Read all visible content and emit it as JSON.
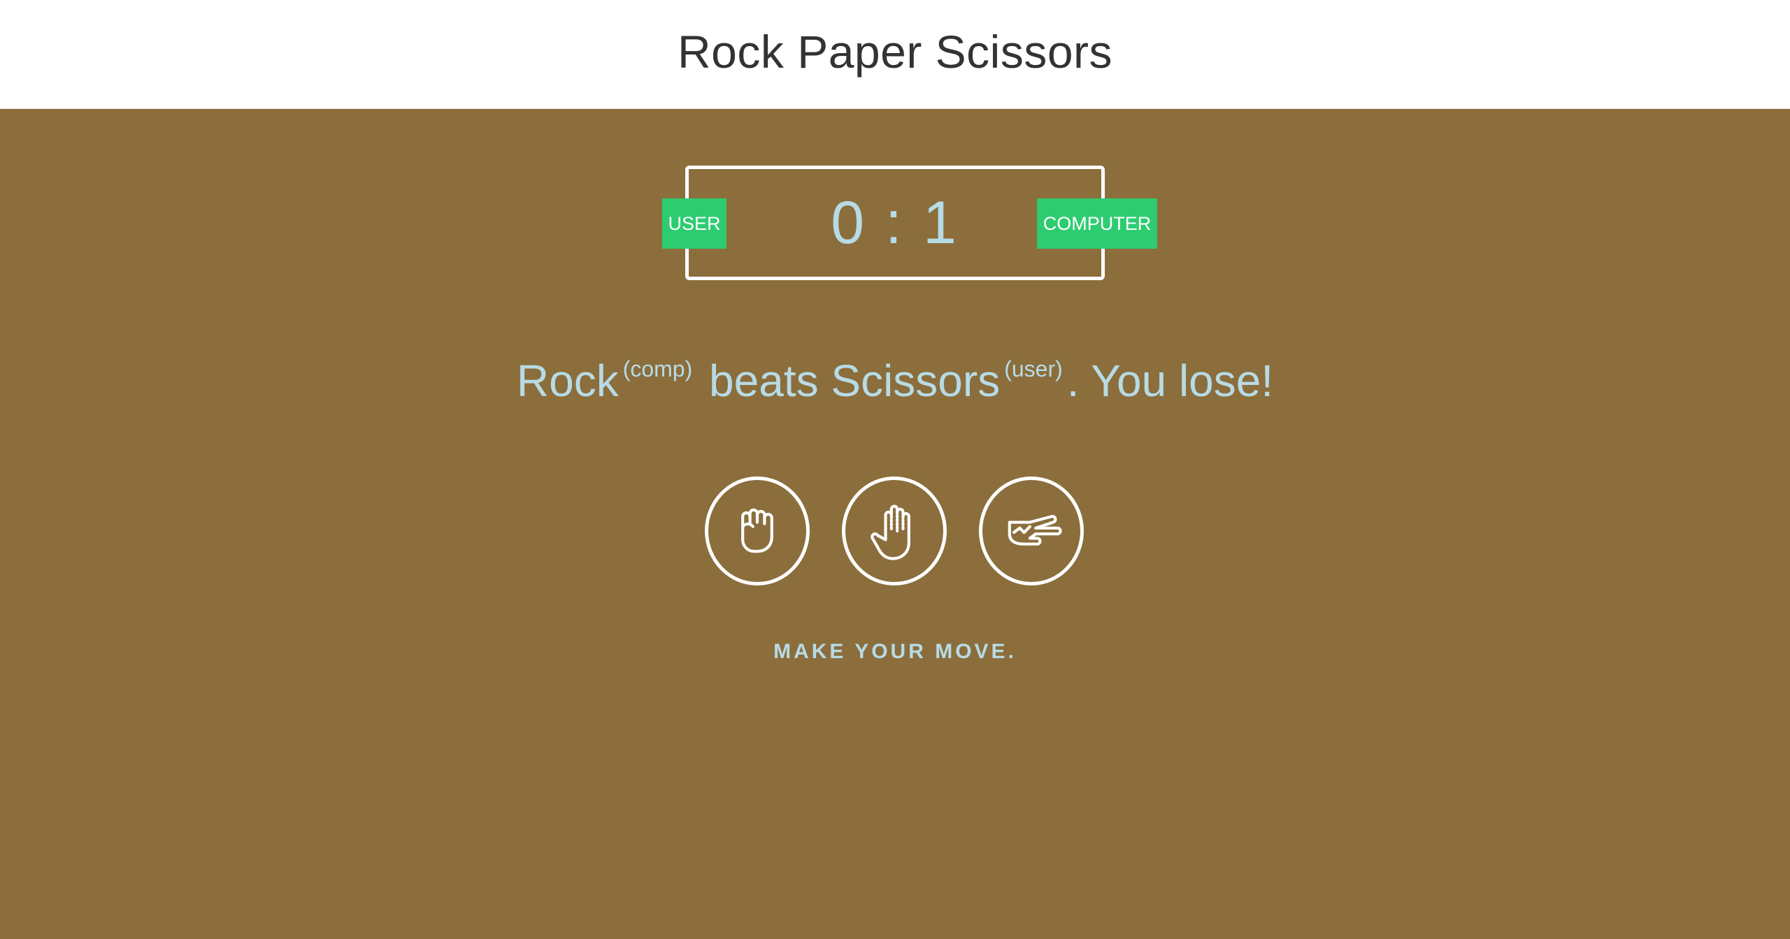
{
  "header": {
    "title": "Rock Paper Scissors"
  },
  "scoreboard": {
    "user_label": "USER",
    "computer_label": "COMPUTER",
    "user_score": "0",
    "separator": ":",
    "computer_score": "1"
  },
  "result": {
    "comp_choice": "Rock",
    "comp_tag": "(comp)",
    "verb": "beats",
    "user_choice": "Scissors",
    "user_tag": "(user)",
    "outcome": ". You lose!"
  },
  "choices": [
    {
      "icon": "rock-fist-icon"
    },
    {
      "icon": "paper-hand-icon"
    },
    {
      "icon": "scissors-hand-icon"
    }
  ],
  "prompt": "MAKE YOUR MOVE.",
  "colors": {
    "background": "#8b6e3c",
    "header_bg": "#ffffff",
    "badge": "#2ecc71",
    "accent_text": "#b7dbe6",
    "border": "#ffffff"
  }
}
